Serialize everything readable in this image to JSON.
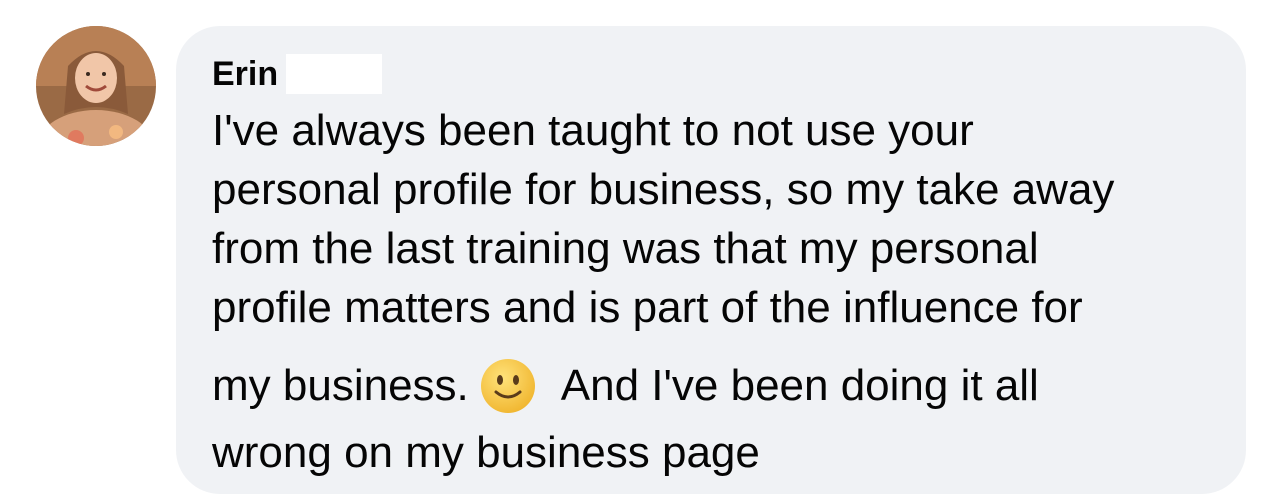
{
  "comment": {
    "author": "Erin",
    "lines_1_4": "I've always been taught to not use your\npersonal profile for business, so my take away\nfrom the last training was that my personal\nprofile matters and is part of the influence for",
    "line5_before_emoji": "my business.",
    "emoji_icon": "slightly-smiling-face-emoji",
    "line5_after_emoji": "And I've been doing it all",
    "line6": "wrong on my business page"
  },
  "colors": {
    "bubble": "#f0f2f5",
    "text": "#050505",
    "emoji_face": "#f7c948"
  }
}
